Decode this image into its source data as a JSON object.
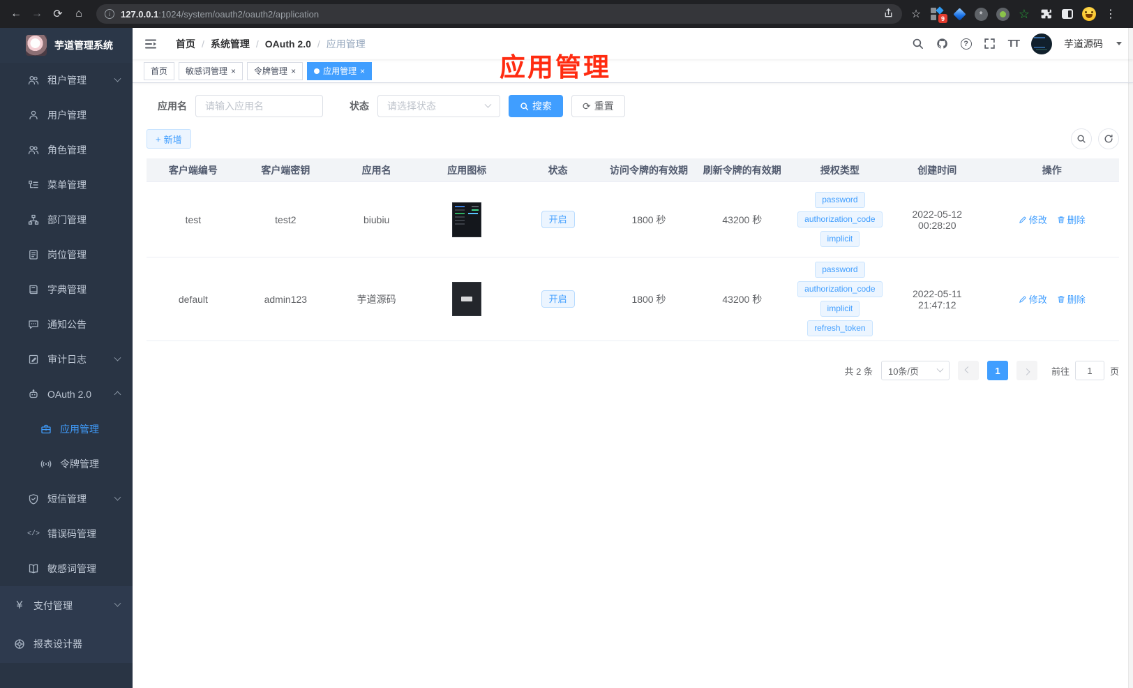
{
  "browser": {
    "back_icon": "←",
    "forward_icon": "→",
    "reload_icon": "⟳",
    "home_icon": "⌂",
    "info_icon": "i",
    "url_host": "127.0.0.1",
    "url_rest": ":1024/system/oauth2/oauth2/application",
    "bookmark_icon": "☆",
    "extension_badge": "9",
    "overflow_icon": "⋮"
  },
  "sidebar": {
    "title": "芋道管理系统",
    "items": [
      {
        "label": "租户管理"
      },
      {
        "label": "用户管理"
      },
      {
        "label": "角色管理"
      },
      {
        "label": "菜单管理"
      },
      {
        "label": "部门管理"
      },
      {
        "label": "岗位管理"
      },
      {
        "label": "字典管理"
      },
      {
        "label": "通知公告"
      },
      {
        "label": "审计日志"
      },
      {
        "label": "OAuth 2.0"
      },
      {
        "label": "应用管理"
      },
      {
        "label": "令牌管理"
      },
      {
        "label": "短信管理"
      },
      {
        "label": "错误码管理"
      },
      {
        "label": "敏感词管理"
      },
      {
        "label": "支付管理"
      },
      {
        "label": "报表设计器"
      }
    ],
    "code_glyph": "</>",
    "yen_glyph": "¥"
  },
  "navbar": {
    "breadcrumb": [
      "首页",
      "系统管理",
      "OAuth 2.0",
      "应用管理"
    ],
    "separator": "/",
    "question_glyph": "?",
    "font_size_glyph": "TT",
    "username": "芋道源码"
  },
  "overlay_title": "应用管理",
  "tabs": [
    {
      "label": "首页"
    },
    {
      "label": "敏感词管理"
    },
    {
      "label": "令牌管理"
    },
    {
      "label": "应用管理"
    }
  ],
  "close_glyph": "×",
  "filter": {
    "name_label": "应用名",
    "name_placeholder": "请输入应用名",
    "status_label": "状态",
    "status_placeholder": "请选择状态",
    "search_label": "搜索",
    "reset_label": "重置",
    "reset_glyph": "⟳",
    "add_glyph": "+",
    "add_label": "新增"
  },
  "table": {
    "headers": [
      "客户端编号",
      "客户端密钥",
      "应用名",
      "应用图标",
      "状态",
      "访问令牌的有效期",
      "刷新令牌的有效期",
      "授权类型",
      "创建时间",
      "操作"
    ],
    "rows": [
      {
        "client_id": "test",
        "secret": "test2",
        "name": "biubiu",
        "icon": "dark-dashboard-screenshot",
        "status": "开启",
        "access_validity": "1800 秒",
        "refresh_validity": "43200 秒",
        "grants": [
          "password",
          "authorization_code",
          "implicit"
        ],
        "created": "2022-05-12 00:28:20"
      },
      {
        "client_id": "default",
        "secret": "admin123",
        "name": "芋道源码",
        "icon": "dark-gitee-logo",
        "status": "开启",
        "access_validity": "1800 秒",
        "refresh_validity": "43200 秒",
        "grants": [
          "password",
          "authorization_code",
          "implicit",
          "refresh_token"
        ],
        "created": "2022-05-11 21:47:12"
      }
    ],
    "actions": {
      "edit": "修改",
      "delete": "删除"
    }
  },
  "pagination": {
    "total": "共 2 条",
    "page_size": "10条/页",
    "page": "1",
    "goto": "前往",
    "goto_value": "1",
    "unit": "页"
  },
  "colors": {
    "accent": "#409eff",
    "annotation_red": "#ff2b10",
    "sidebar_bg": "#293444"
  }
}
